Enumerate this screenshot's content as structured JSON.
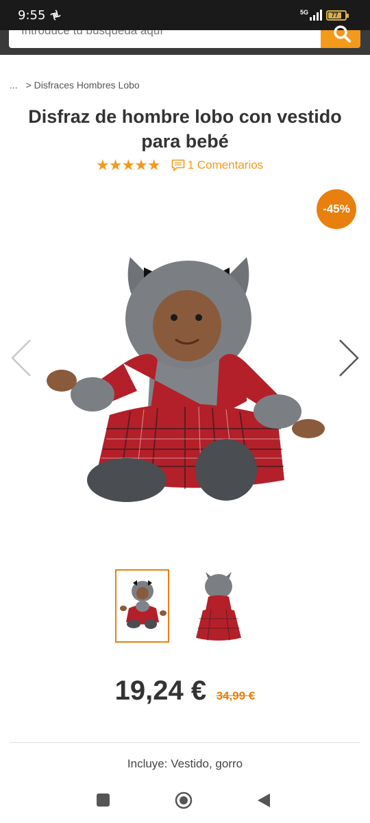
{
  "status": {
    "time": "9:55",
    "network": "5G",
    "battery": "77"
  },
  "search": {
    "placeholder": "Introduce tu búsqueda aquí",
    "icon": "search-icon"
  },
  "breadcrumb": {
    "ellipsis": "...",
    "separator": ">",
    "category": "Disfraces Hombres Lobo"
  },
  "product": {
    "title": "Disfraz de hombre lobo con vestido para bebé",
    "stars": "★★★★★",
    "rating": 5,
    "comments_label": "1 Comentarios",
    "discount": "-45%",
    "price": "19,24 €",
    "old_price": "34,99 €",
    "includes": "Incluye: Vestido, gorro"
  },
  "gallery": {
    "images": [
      "baby-werewolf-costume-front",
      "baby-werewolf-costume-back"
    ],
    "selected_index": 0
  },
  "colors": {
    "accent": "#f39a1a",
    "discount_badge": "#e8800f",
    "header": "#3a3a3a"
  }
}
